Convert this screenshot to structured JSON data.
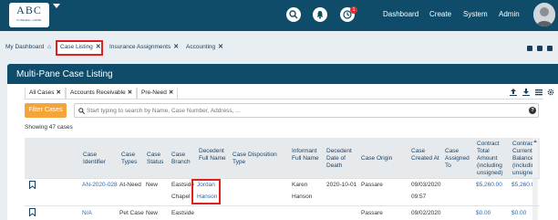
{
  "logo": {
    "main": "ABC",
    "sub": "FUNERAL HOME"
  },
  "nav": {
    "notification_count": "1",
    "links": [
      "Dashboard",
      "Create",
      "System",
      "Admin"
    ]
  },
  "tabs": [
    {
      "label": "My Dashboard"
    },
    {
      "label": "Case Listing"
    },
    {
      "label": "Insurance Assignments"
    },
    {
      "label": "Accounting"
    }
  ],
  "panel": {
    "title": "Multi-Pane Case Listing"
  },
  "subtabs": [
    {
      "label": "All Cases"
    },
    {
      "label": "Accounts Receivable"
    },
    {
      "label": "Pre-Need"
    }
  ],
  "filter": {
    "button_label": "Filter Cases",
    "search_placeholder": "Start typing to search by Name, Case Number, Address, ..."
  },
  "showing_text": "Showing 47 cases",
  "table": {
    "columns": [
      "Case Identifier",
      "Case Types",
      "Case Status",
      "Case Branch",
      "Decedent Full Name",
      "Case Disposition Type",
      "Informant Full Name",
      "Decedent Date of Death",
      "Case Origin",
      "Case Created At",
      "Case Assigned To",
      "Contract Total Amount (including unsigned)",
      "Contract Current Balance (including unsigned)"
    ],
    "rows": [
      {
        "case_identifier": "AN-2020-028",
        "case_types": "At-Need",
        "case_status": "New",
        "case_branch_1": "Eastside",
        "case_branch_2": "Chapel",
        "decedent_first": "Jordan",
        "decedent_last": "Hanson",
        "informant_first": "Karen",
        "informant_last": "Hanson",
        "date_of_death": "2020-10-01",
        "case_origin": "Passare",
        "created_date": "09/03/2020",
        "created_time": "09:57",
        "contract_total": "$5,260.00",
        "contract_balance": "$5,260.00"
      },
      {
        "case_identifier": "N/A",
        "case_types": "Pet Case",
        "case_status": "New",
        "case_branch_1": "Eastside",
        "case_origin": "Passare",
        "created_date": "09/02/2020",
        "contract_total": "$0.00",
        "contract_balance": "$0.00"
      }
    ]
  }
}
